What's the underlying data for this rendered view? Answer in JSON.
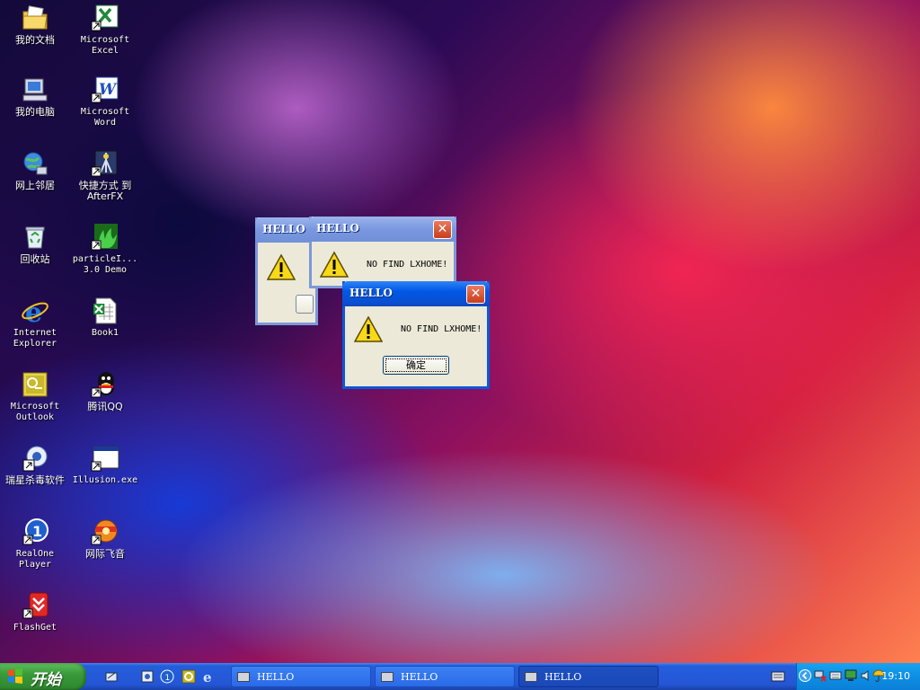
{
  "desktop": {
    "icons": [
      {
        "label": "我的文档",
        "icon": "my-documents-icon"
      },
      {
        "label": "Microsoft\nExcel",
        "icon": "excel-icon"
      },
      {
        "label": "我的电脑",
        "icon": "my-computer-icon"
      },
      {
        "label": "Microsoft\nWord",
        "icon": "word-icon"
      },
      {
        "label": "网上邻居",
        "icon": "network-places-icon"
      },
      {
        "label": "快捷方式 到\nAfterFX",
        "icon": "afterfx-icon"
      },
      {
        "label": "回收站",
        "icon": "recycle-bin-icon"
      },
      {
        "label": "particleI...\n3.0 Demo",
        "icon": "particle-demo-icon"
      },
      {
        "label": "Internet\nExplorer",
        "icon": "internet-explorer-icon"
      },
      {
        "label": "Book1",
        "icon": "excel-book-icon"
      },
      {
        "label": "Microsoft\nOutlook",
        "icon": "outlook-icon"
      },
      {
        "label": "腾讯QQ",
        "icon": "qq-icon"
      },
      {
        "label": "瑞星杀毒软件",
        "icon": "rising-antivirus-icon"
      },
      {
        "label": "Illusion.exe",
        "icon": "exe-window-icon"
      },
      {
        "label": "RealOne\nPlayer",
        "icon": "realone-player-icon"
      },
      {
        "label": "网际飞音",
        "icon": "donar-icon"
      },
      {
        "label": "FlashGet",
        "icon": "flashget-icon"
      }
    ]
  },
  "dialogs": [
    {
      "title": "HELLO",
      "message": "",
      "ok_label": "",
      "state": "inactive"
    },
    {
      "title": "HELLO",
      "message": "NO FIND LXHOME!",
      "ok_label": "",
      "state": "inactive"
    },
    {
      "title": "HELLO",
      "message": "NO FIND LXHOME!",
      "ok_label": "确定",
      "state": "active"
    }
  ],
  "dialog_close_glyph": "✕",
  "taskbar": {
    "start_label": "开始",
    "tasks": [
      {
        "label": "HELLO",
        "active": false
      },
      {
        "label": "HELLO",
        "active": false
      },
      {
        "label": "HELLO",
        "active": true
      }
    ],
    "clock": "19:10"
  },
  "colors": {
    "taskbar_blue": "#245edb",
    "start_green": "#3a9a3a",
    "title_active": "#0058e6",
    "title_inactive": "#7a98e0",
    "dialog_body": "#ece9d8",
    "close_red": "#c93d1b"
  }
}
